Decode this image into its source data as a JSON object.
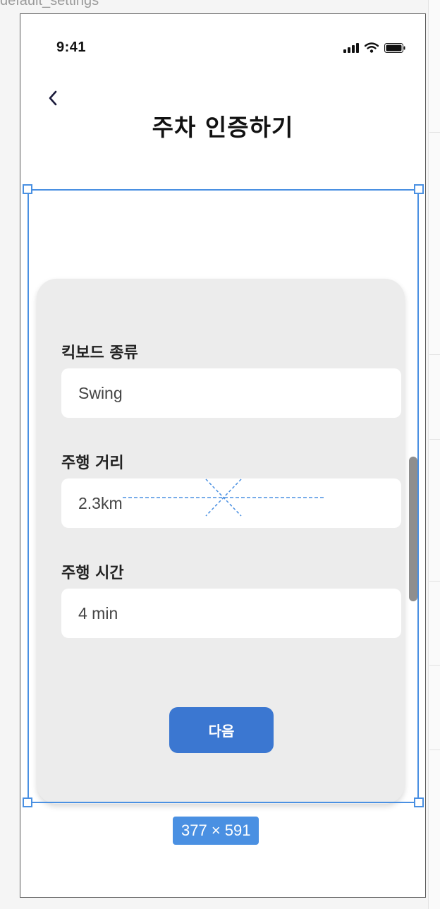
{
  "canvas": {
    "frame_label": "default_settings",
    "size_badge": "377 × 591"
  },
  "status_bar": {
    "time": "9:41",
    "icons": [
      "signal-icon",
      "wifi-icon",
      "battery-icon"
    ]
  },
  "header": {
    "back_icon": "chevron-left-icon",
    "title": "주차 인증하기"
  },
  "form": {
    "fields": [
      {
        "label": "킥보드 종류",
        "value": "Swing"
      },
      {
        "label": "주행 거리",
        "value": "2.3km"
      },
      {
        "label": "주행 시간",
        "value": "4 min"
      }
    ],
    "next_button": "다음"
  },
  "colors": {
    "accent": "#3b77d1",
    "selection": "#4a90e2",
    "card_bg": "#ececec"
  }
}
